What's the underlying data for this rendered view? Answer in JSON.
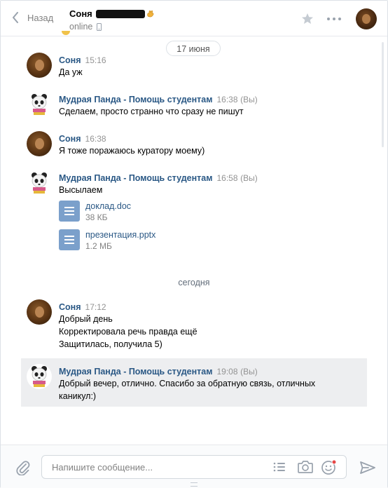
{
  "header": {
    "back_label": "Назад",
    "peer_name": "Соня",
    "status": "online"
  },
  "dates": {
    "first": "17 июня",
    "today": "сегодня"
  },
  "messages": [
    {
      "author": "Соня",
      "time": "15:16",
      "lines": [
        "Да уж"
      ]
    },
    {
      "author": "Мудрая Панда - Помощь студентам",
      "time": "16:38",
      "you": "(Вы)",
      "lines": [
        "Сделаем, просто странно что сразу не пишут"
      ]
    },
    {
      "author": "Соня",
      "time": "16:38",
      "lines": [
        "Я тоже поражаюсь куратору моему)"
      ]
    },
    {
      "author": "Мудрая Панда - Помощь студентам",
      "time": "16:58",
      "you": "(Вы)",
      "lines": [
        "Высылаем"
      ],
      "docs": [
        {
          "name": "доклад.doc",
          "size": "38 КБ"
        },
        {
          "name": "презентация.pptx",
          "size": "1.2 МБ"
        }
      ]
    },
    {
      "author": "Соня",
      "time": "17:12",
      "lines": [
        "Добрый день",
        "Корректировала речь правда ещё",
        "Защитилась, получила 5)"
      ]
    },
    {
      "author": "Мудрая Панда - Помощь студентам",
      "time": "19:08",
      "you": "(Вы)",
      "lines": [
        "Добрый вечер, отлично. Спасибо за обратную связь, отличных",
        "каникул:)"
      ]
    }
  ],
  "composer": {
    "placeholder": "Напишите сообщение..."
  },
  "icons": {
    "back": "chevron-left-icon",
    "star": "star-icon",
    "more": "more-dots-icon",
    "phone": "mobile-phone-icon",
    "attach": "paperclip-icon",
    "template": "list-icon",
    "camera": "camera-icon",
    "emoji": "emoji-icon",
    "send": "send-icon"
  },
  "colors": {
    "link": "#2a5885",
    "doc_icon": "#7ba0cb",
    "highlight": "#edeef0",
    "notification_dot": "#e64646"
  }
}
